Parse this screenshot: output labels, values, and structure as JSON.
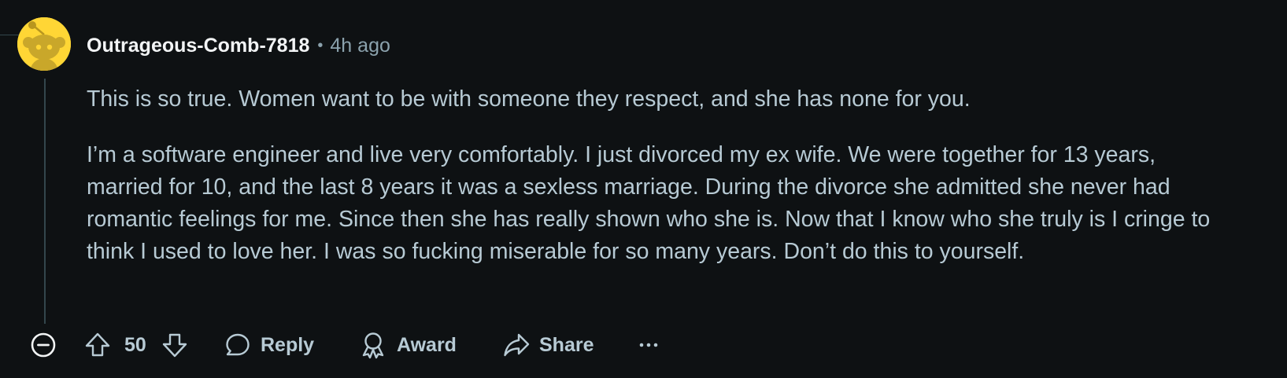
{
  "comment": {
    "author": "Outrageous-Comb-7818",
    "separator": "•",
    "timestamp": "4h ago",
    "paragraphs": [
      "This is so true. Women want to be with someone they respect, and she has none for you.",
      "I’m a software engineer and live very comfortably. I just divorced my ex wife. We were together for 13 years, married for 10, and the last 8 years it was a sexless marriage. During the divorce she admitted she never had romantic feelings for me. Since then she has really shown who she is. Now that I know who she truly is I cringe to think I used to love her. I was so fucking miserable for so many years. Don’t do this to yourself."
    ]
  },
  "actions": {
    "score": "50",
    "reply_label": "Reply",
    "award_label": "Award",
    "share_label": "Share"
  },
  "colors": {
    "background": "#0e1113",
    "username": "#f2f4f5",
    "text": "#b7cad4",
    "meta": "#8ba2ad",
    "thread_line": "#33464c",
    "avatar_bg": "#ffd635",
    "avatar_fg": "#c9a72a"
  },
  "icons": {
    "avatar": "snoo-avatar-icon",
    "collapse": "minus-circle-icon",
    "upvote": "upvote-arrow-icon",
    "downvote": "downvote-arrow-icon",
    "reply": "speech-bubble-icon",
    "award": "award-ribbon-icon",
    "share": "share-arrow-icon",
    "more": "ellipsis-icon"
  }
}
